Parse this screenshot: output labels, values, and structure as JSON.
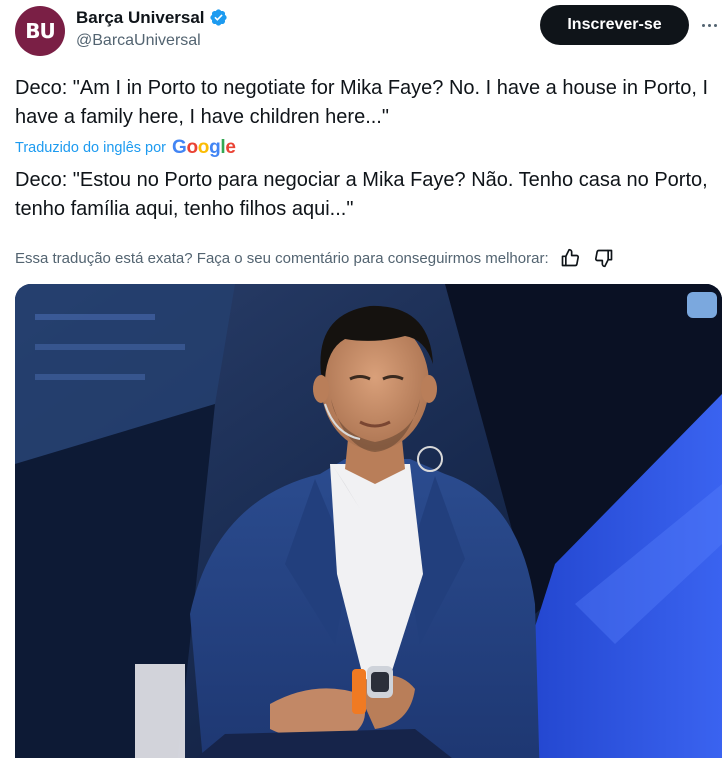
{
  "account": {
    "avatar_text": "BU",
    "display_name": "Barça Universal",
    "handle": "@BarcaUniversal"
  },
  "actions": {
    "subscribe_label": "Inscrever-se"
  },
  "tweet": {
    "original_text": "Deco: \"Am I in Porto to negotiate for Mika Faye? No. I have a house in Porto, I have a family here, I have children here...\"",
    "translated_label": "Traduzido do inglês por",
    "translator": "Google",
    "translated_text": "Deco: \"Estou no Porto para negociar a Mika Faye? Não. Tenho casa no Porto, tenho família aqui, tenho filhos aqui...\"",
    "feedback_prompt": "Essa tradução está exata? Faça o seu comentário para conseguirmos melhorar:"
  },
  "icons": {
    "verified": "verified-badge-icon",
    "more": "more-options-icon",
    "thumbs_up": "thumbs-up-icon",
    "thumbs_down": "thumbs-down-icon"
  },
  "colors": {
    "avatar_bg": "#7a1f45",
    "verified_blue": "#1d9bf0",
    "link_blue": "#1d9bf0",
    "button_bg": "#0f1419",
    "muted_text": "#536471",
    "google_blue": "#4285f4",
    "google_red": "#ea4335",
    "google_yellow": "#fbbc05",
    "google_green": "#34a853"
  }
}
